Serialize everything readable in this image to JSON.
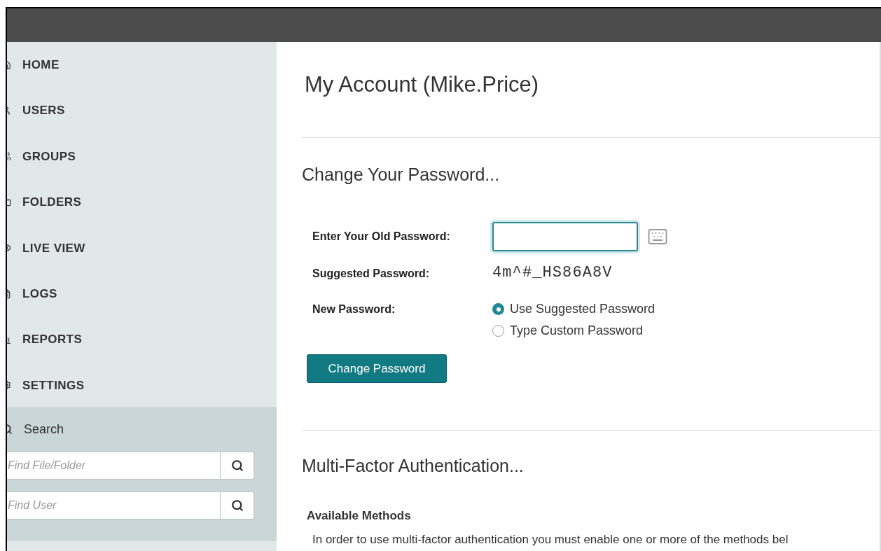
{
  "nav": [
    {
      "label": "HOME"
    },
    {
      "label": "USERS"
    },
    {
      "label": "GROUPS"
    },
    {
      "label": "FOLDERS"
    },
    {
      "label": "LIVE VIEW"
    },
    {
      "label": "LOGS"
    },
    {
      "label": "REPORTS"
    },
    {
      "label": "SETTINGS"
    }
  ],
  "search": {
    "title": "Search",
    "fields": [
      {
        "placeholder": "Find File/Folder"
      },
      {
        "placeholder": "Find User"
      }
    ]
  },
  "page_title": "My Account (Mike.Price)",
  "password": {
    "heading": "Change Your Password...",
    "old_label": "Enter Your Old Password:",
    "suggested_label": "Suggested Password:",
    "suggested_value": "4m^#_HS86A8V",
    "new_label": "New Password:",
    "options": [
      {
        "label": "Use Suggested Password",
        "selected": true
      },
      {
        "label": "Type Custom Password",
        "selected": false
      }
    ],
    "button": "Change Password"
  },
  "mfa": {
    "heading": "Multi-Factor Authentication...",
    "subheading": "Available Methods",
    "text": "In order to use multi-factor authentication you must enable one or more of the methods bel"
  }
}
